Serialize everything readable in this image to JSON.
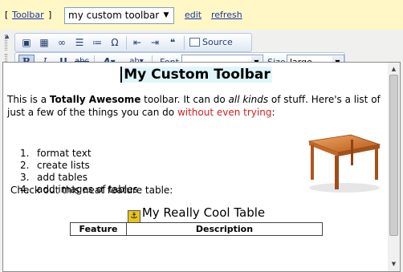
{
  "topbar": {
    "toolbar_link": "Toolbar",
    "toolbar_select_value": "my custom toolbar",
    "edit_link": "edit",
    "refresh_link": "refresh"
  },
  "toolbar": {
    "source_label": "Source",
    "font_label": "Font",
    "font_value": "",
    "size_label": "Size",
    "size_value": "large"
  },
  "document": {
    "title": "My Custom Toolbar",
    "intro_1": "This is a ",
    "intro_bold": "Totally Awesome",
    "intro_2": " toolbar. It can do ",
    "intro_italic": "all kinds",
    "intro_3": " of stuff. Here's a list of just a few of the things you can do ",
    "intro_red": "without even trying",
    "intro_4": ":",
    "list": [
      {
        "num": "1.",
        "text": "format text"
      },
      {
        "num": "2.",
        "text": "create lists"
      },
      {
        "num": "3.",
        "text": "add tables"
      },
      {
        "num": "4.",
        "text": "add images of tables"
      }
    ],
    "feature_intro": "Check out this neat feature table:",
    "table_caption": "My Really Cool Table",
    "table_headers": [
      "Feature",
      "Description"
    ]
  },
  "colors": {
    "topbar_bg": "#fff8c6",
    "link": "#1a33a6",
    "highlight_red": "#d62020",
    "title_highlight": "#e0f6fb"
  }
}
